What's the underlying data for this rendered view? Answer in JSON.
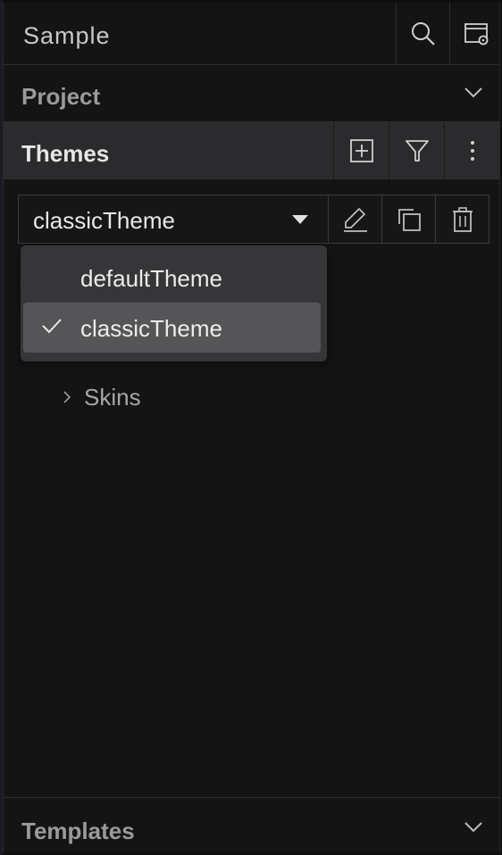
{
  "header": {
    "title": "Sample",
    "search_icon": "search-icon",
    "settings_icon": "window-settings-icon"
  },
  "project": {
    "title": "Project"
  },
  "themes": {
    "title": "Themes",
    "actions": [
      "add-icon",
      "filter-icon",
      "more-vertical-icon"
    ]
  },
  "selector": {
    "value": "classicTheme"
  },
  "selector_actions": [
    "edit-icon",
    "duplicate-icon",
    "delete-icon"
  ],
  "dropdown": {
    "options": [
      {
        "label": "defaultTheme",
        "selected": false
      },
      {
        "label": "classicTheme",
        "selected": true
      }
    ]
  },
  "tree": {
    "skins_label": "Skins"
  },
  "templates": {
    "title": "Templates"
  },
  "colors": {
    "background": "#141415",
    "selected_row": "#555557",
    "section_active": "#2b2b2d"
  }
}
